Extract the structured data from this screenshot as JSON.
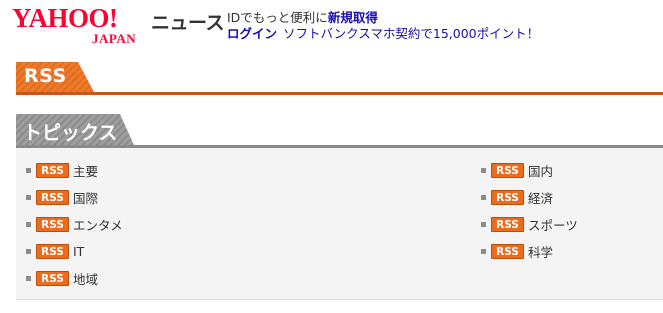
{
  "header": {
    "logo_text": "YAHOO!",
    "logo_sub": "JAPAN",
    "service_name": "ニュース",
    "promo_prefix": "IDでもっと便利に",
    "promo_link": "新規取得",
    "login_label": "ログイン",
    "offer_text": "ソフトバンクスマホ契約で15,000ポイント！"
  },
  "sections": {
    "rss_title": "RSS",
    "topics_title": "トピックス"
  },
  "badge_label": "RSS",
  "topics_left": [
    {
      "label": "主要"
    },
    {
      "label": "国際"
    },
    {
      "label": "エンタメ"
    },
    {
      "label": "IT"
    },
    {
      "label": "地域"
    }
  ],
  "topics_right": [
    {
      "label": "国内"
    },
    {
      "label": "経済"
    },
    {
      "label": "スポーツ"
    },
    {
      "label": "科学"
    }
  ],
  "colors": {
    "logo": "#ff0033",
    "rss_orange": "#ec6b1c",
    "link_blue": "#1a0dab",
    "gray_tab": "#9e9e9e"
  }
}
